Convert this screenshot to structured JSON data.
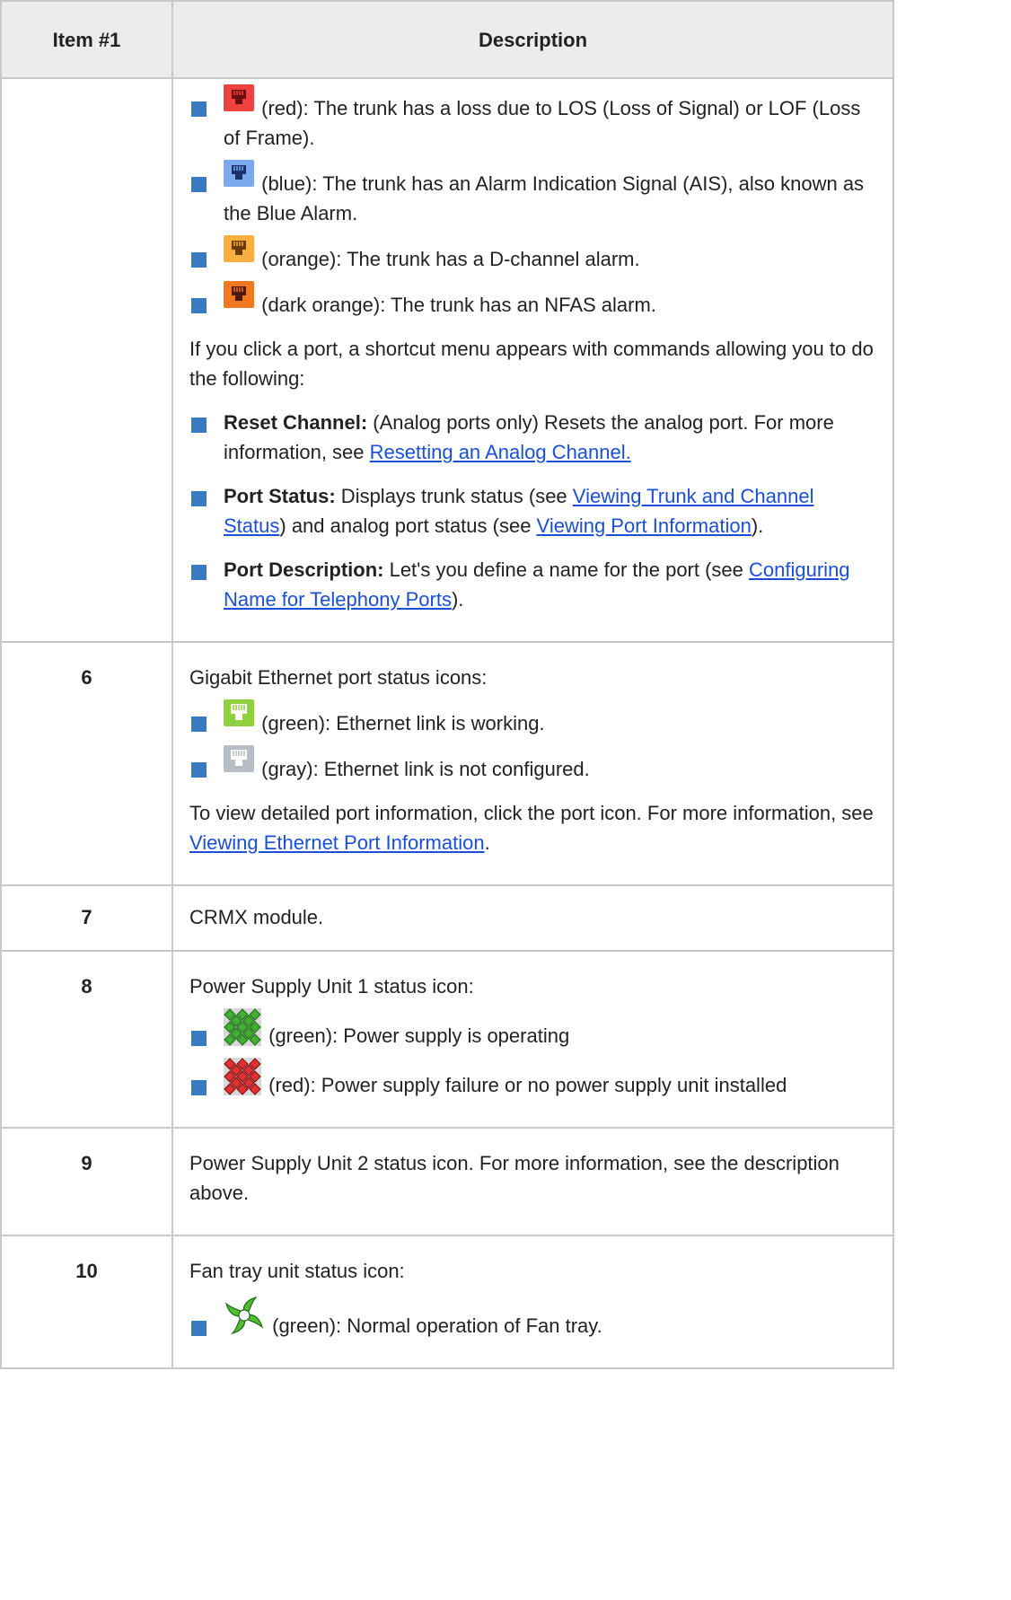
{
  "table": {
    "header": {
      "item": "Item #1",
      "description": "Description"
    },
    "row_cont": {
      "bullets": [
        {
          "icon": "trunk-port-red-icon",
          "color": "#f04040",
          "text": "(red): The trunk has a loss due to LOS (Loss of Signal) or LOF (Loss of Frame)."
        },
        {
          "icon": "trunk-port-blue-icon",
          "color": "#7aa9f0",
          "text": "(blue): The trunk has an Alarm Indication Signal (AIS), also known as the Blue Alarm."
        },
        {
          "icon": "trunk-port-orange-icon",
          "color": "#f7b040",
          "text": "(orange): The trunk has a D-channel alarm."
        },
        {
          "icon": "trunk-port-dark-orange-icon",
          "color": "#f07820",
          "text": "(dark orange): The trunk has an NFAS alarm."
        }
      ],
      "shortcut_intro": "If you click a port, a shortcut menu appears with commands allowing you to do the following:",
      "reset": {
        "bold": "Reset Channel:",
        "text": " (Analog ports only) Resets the analog port. For more information, see ",
        "link": "Resetting an Analog Channel."
      },
      "status": {
        "bold": "Port Status:",
        "text1": " Displays trunk status (see ",
        "link1": "Viewing Trunk and Channel Status",
        "text2": ") and analog port status (see ",
        "link2": "Viewing Port Information",
        "text3": ")."
      },
      "portdesc": {
        "bold": "Port Description:",
        "text1": " Let's you define a name for the port (see ",
        "link": "Configuring Name for Telephony Ports",
        "text2": ")."
      }
    },
    "row6": {
      "item": "6",
      "intro": "Gigabit Ethernet port status icons:",
      "green": {
        "icon": "ethernet-port-green-icon",
        "color": "#8fd040",
        "text": "(green): Ethernet link is working."
      },
      "gray": {
        "icon": "ethernet-port-gray-icon",
        "color": "#b8bcc4",
        "text": "(gray): Ethernet link is not configured."
      },
      "outro1": "To view detailed port information, click the port icon. For more information, see ",
      "outro_link": "Viewing Ethernet Port Information",
      "outro2": "."
    },
    "row7": {
      "item": "7",
      "text": "CRMX module."
    },
    "row8": {
      "item": "8",
      "intro": "Power Supply Unit 1 status icon:",
      "green": {
        "icon": "power-supply-green-icon",
        "color": "#40b030",
        "text": "(green): Power supply is operating"
      },
      "red": {
        "icon": "power-supply-red-icon",
        "color": "#e03030",
        "text": "(red): Power supply failure or no power supply unit installed"
      }
    },
    "row9": {
      "item": "9",
      "text": "Power Supply Unit 2 status icon. For more information, see the description above."
    },
    "row10": {
      "item": "10",
      "intro": "Fan tray unit status icon:",
      "green": {
        "icon": "fan-tray-green-icon",
        "color": "#50c030",
        "text": "(green): Normal operation of Fan tray."
      }
    }
  }
}
